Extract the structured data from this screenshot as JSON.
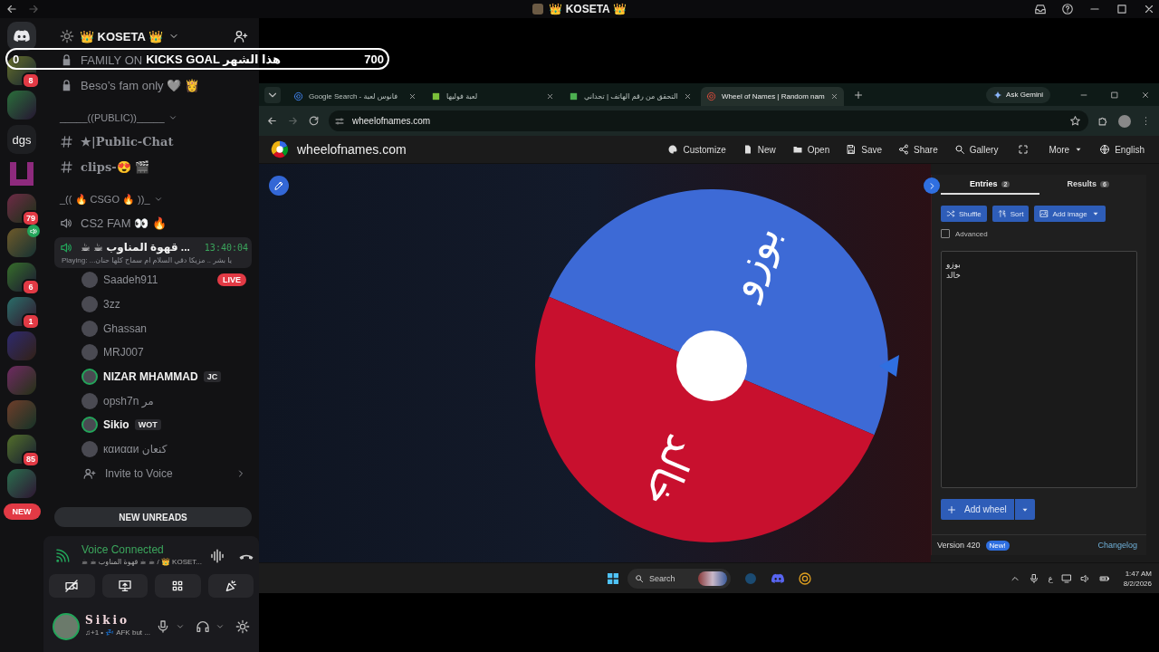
{
  "titlebar": {
    "title": "👑 KOSETA 👑"
  },
  "servers": [
    {
      "kind": "home"
    },
    {
      "kind": "image",
      "badge": "8"
    },
    {
      "kind": "image"
    },
    {
      "kind": "text",
      "label": "dgs"
    },
    {
      "kind": "logo"
    },
    {
      "kind": "image",
      "badge": "79"
    },
    {
      "kind": "image_voice"
    },
    {
      "kind": "image",
      "badge": "6"
    },
    {
      "kind": "image",
      "badge": "1"
    },
    {
      "kind": "image"
    },
    {
      "kind": "image"
    },
    {
      "kind": "image"
    },
    {
      "kind": "image",
      "badge": "85"
    },
    {
      "kind": "image"
    }
  ],
  "new_pill": "NEW",
  "goal_overlay": {
    "start": "0",
    "title": "KICKS GOAL هذا الشهر",
    "target": "700"
  },
  "server": {
    "name": "👑 KOSETA 👑"
  },
  "channels": [
    {
      "kind": "locked",
      "name": "FAMILY ON"
    },
    {
      "kind": "locked",
      "name": "Beso’s fam only 🩶 👸"
    },
    {
      "kind": "category",
      "name": "_____((PUBLIC))_____"
    },
    {
      "kind": "text",
      "name": "★|Public-Chat"
    },
    {
      "kind": "text",
      "name": "clips-😍 🎬"
    },
    {
      "kind": "category",
      "name": "_(( 🔥 CSGO 🔥 ))_"
    },
    {
      "kind": "voice",
      "name": "CS2 FAM 👀 🔥"
    }
  ],
  "active_voice": {
    "name": "☕ ☕ قهوة المناوب ...",
    "time": "13:40:04",
    "activity": "Playing: ...يا بشر .. مزيكا دقي السلام ام سماح كلها حنان"
  },
  "members": [
    {
      "name": "Saadeh911",
      "speaking": false,
      "badge": "LIVE"
    },
    {
      "name": "3zz",
      "speaking": false
    },
    {
      "name": "Ghassan",
      "speaking": false
    },
    {
      "name": "MRJ007",
      "speaking": false
    },
    {
      "name": "NIZAR MHAMMAD",
      "speaking": true,
      "tag": "JC"
    },
    {
      "name": "opsh7n مر",
      "speaking": false
    },
    {
      "name": "Sikio",
      "speaking": true,
      "tag": "WOT"
    },
    {
      "name": "кαиααи كنعان",
      "speaking": false
    }
  ],
  "invite": "Invite to Voice",
  "new_unreads": "NEW UNREADS",
  "voice_panel": {
    "status": "Voice Connected",
    "location": "☕ ☕ قهوة المناوب ☕ ☕ / 👑 KOSET..."
  },
  "user": {
    "name": "Sikio",
    "status": "♫+1 • 💤 AFK but ..."
  },
  "browser": {
    "tabs": [
      {
        "kind": "google",
        "title": "Google Search - فانوس لعبة",
        "selected": false
      },
      {
        "kind": "site",
        "title": "لعبة فوليها",
        "selected": false
      },
      {
        "kind": "doc",
        "title": "التحقق من رقم الهاتف | تحداني",
        "selected": false
      },
      {
        "kind": "wheel",
        "title": "Wheel of Names | Random nam",
        "selected": true
      }
    ],
    "gemini": "Ask Gemini",
    "url": "wheelofnames.com"
  },
  "site": {
    "brand": "wheelofnames.com",
    "nav": [
      {
        "kind": "palette",
        "label": "Customize"
      },
      {
        "kind": "file",
        "label": "New"
      },
      {
        "kind": "folder",
        "label": "Open"
      },
      {
        "kind": "save",
        "label": "Save"
      },
      {
        "kind": "share",
        "label": "Share"
      },
      {
        "kind": "search",
        "label": "Gallery"
      },
      {
        "kind": "fullscreen"
      },
      {
        "kind": "more",
        "label": "More"
      },
      {
        "kind": "globe",
        "label": "English"
      }
    ]
  },
  "wheel": {
    "slices": [
      {
        "label": "بوزو",
        "color": "#3d6ad6"
      },
      {
        "label": "خالد",
        "color": "#c8102e"
      }
    ]
  },
  "panel": {
    "tabs": [
      {
        "label": "Entries",
        "count": "2",
        "selected": true
      },
      {
        "label": "Results",
        "count": "6",
        "selected": false
      }
    ],
    "tools": [
      {
        "kind": "shuffle",
        "label": "Shuffle"
      },
      {
        "kind": "sort",
        "label": "Sort"
      },
      {
        "kind": "image",
        "label": "Add image"
      }
    ],
    "advanced": {
      "label": "Advanced",
      "checked": false
    },
    "entries": [
      "بوزو",
      "خالد"
    ],
    "add_wheel": "Add wheel",
    "version": "Version 420",
    "version_badge": "New!",
    "changelog": "Changelog"
  },
  "taskbar": {
    "search": "Search",
    "language": "ع",
    "time": "1:47 AM",
    "date": "8/2/2026"
  }
}
